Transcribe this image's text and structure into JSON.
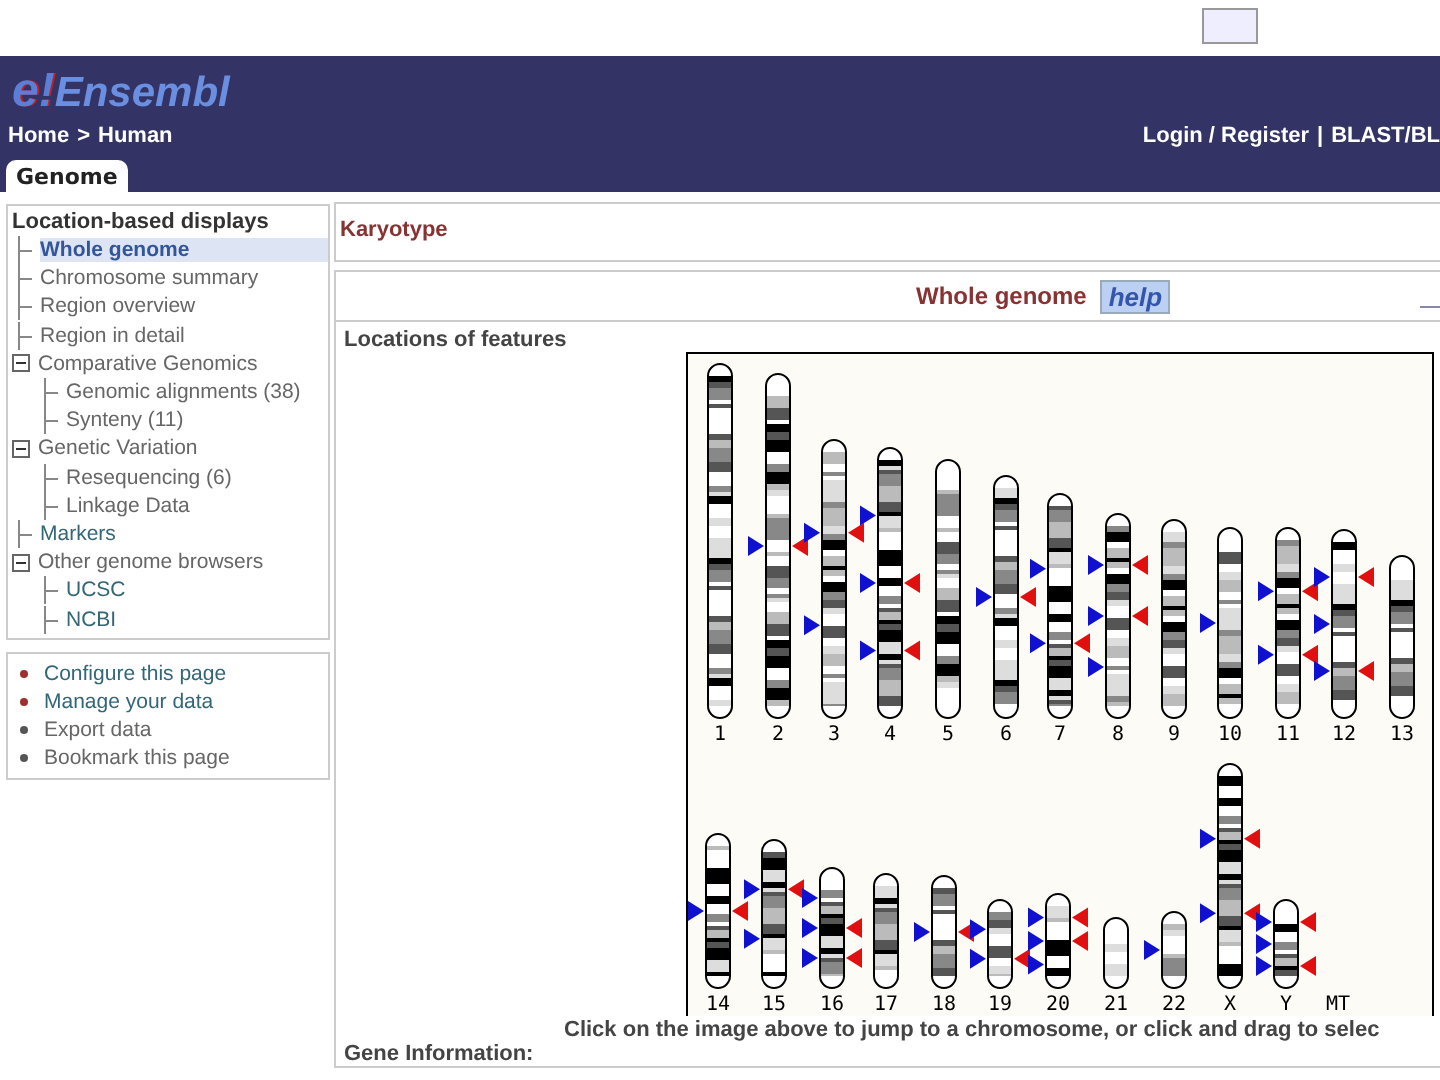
{
  "header": {
    "logo_mark": "e!",
    "logo_text": "Ensembl",
    "breadcrumb": [
      {
        "label": "Home"
      },
      {
        "label": ">"
      },
      {
        "label": "Human"
      }
    ],
    "links": [
      {
        "label": "Login / Register"
      },
      {
        "label": "|"
      },
      {
        "label": "BLAST/BL"
      }
    ],
    "tabs": [
      {
        "label": "Genome",
        "selected": true
      }
    ]
  },
  "sidebar": {
    "title": "Location-based displays",
    "items": [
      {
        "label": "Whole genome",
        "selected": true,
        "disabled": false
      },
      {
        "label": "Chromosome summary",
        "selected": false,
        "disabled": true
      },
      {
        "label": "Region overview",
        "selected": false,
        "disabled": true
      },
      {
        "label": "Region in detail",
        "selected": false,
        "disabled": true
      },
      {
        "label": "Comparative Genomics",
        "selected": false,
        "disabled": true,
        "expanded": true,
        "children": [
          {
            "label": "Genomic alignments (38)",
            "selected": false,
            "disabled": true
          },
          {
            "label": "Synteny (11)",
            "selected": false,
            "disabled": true
          }
        ]
      },
      {
        "label": "Genetic Variation",
        "selected": false,
        "disabled": true,
        "expanded": true,
        "children": [
          {
            "label": "Resequencing (6)",
            "selected": false,
            "disabled": true
          },
          {
            "label": "Linkage Data",
            "selected": false,
            "disabled": true
          }
        ]
      },
      {
        "label": "Markers",
        "selected": false,
        "disabled": false
      },
      {
        "label": "Other genome browsers",
        "selected": false,
        "disabled": true,
        "expanded": true,
        "children": [
          {
            "label": "UCSC",
            "selected": false,
            "disabled": false
          },
          {
            "label": "NCBI",
            "selected": false,
            "disabled": false
          }
        ]
      }
    ],
    "actions": [
      {
        "label": "Configure this page",
        "disabled": false
      },
      {
        "label": "Manage your data",
        "disabled": false
      },
      {
        "label": "Export data",
        "disabled": true
      },
      {
        "label": "Bookmark this page",
        "disabled": true
      }
    ]
  },
  "main": {
    "title": "Karyotype",
    "panel_title": "Whole genome",
    "help": "help",
    "section_label": "Locations of features",
    "karyotype_rows": [
      [
        "1",
        "2",
        "3",
        "4",
        "5",
        "6",
        "7",
        "8",
        "9",
        "10",
        "11",
        "12",
        "13"
      ],
      [
        "14",
        "15",
        "16",
        "17",
        "18",
        "19",
        "20",
        "21",
        "22",
        "X",
        "Y",
        "MT"
      ]
    ],
    "caption": "Click on the image above to jump to a chromosome, or click and drag to selec",
    "next_section": "Gene Information:"
  }
}
